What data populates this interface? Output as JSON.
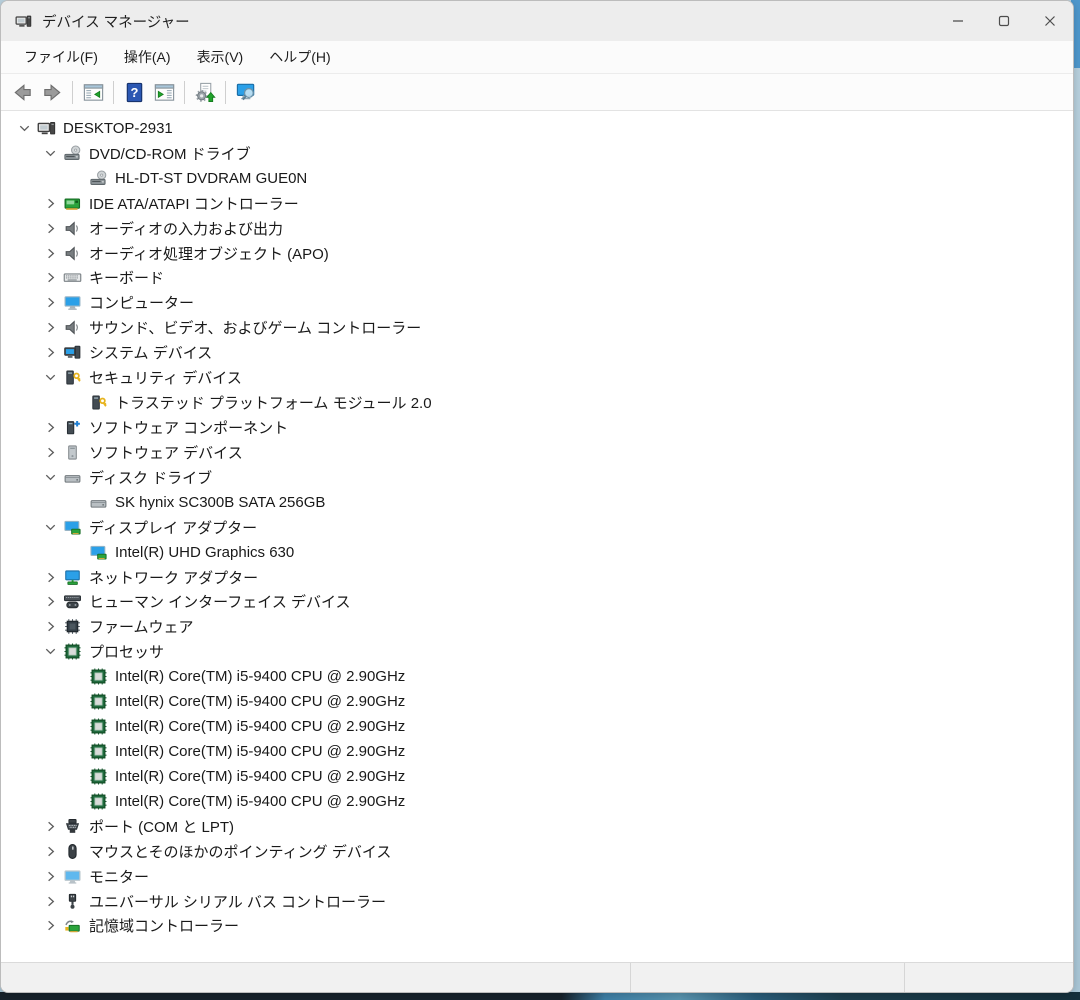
{
  "window": {
    "title": "デバイス マネージャー",
    "controls": [
      {
        "name": "minimize",
        "glyph": "minimize"
      },
      {
        "name": "maximize",
        "glyph": "maximize"
      },
      {
        "name": "close",
        "glyph": "close"
      }
    ]
  },
  "menu": {
    "items": [
      {
        "name": "file",
        "label": "ファイル(F)"
      },
      {
        "name": "action",
        "label": "操作(A)"
      },
      {
        "name": "view",
        "label": "表示(V)"
      },
      {
        "name": "help",
        "label": "ヘルプ(H)"
      }
    ]
  },
  "toolbar": {
    "buttons": [
      {
        "type": "button",
        "name": "back",
        "icon": "back-arrow"
      },
      {
        "type": "button",
        "name": "forward",
        "icon": "forward-arrow"
      },
      {
        "type": "separator"
      },
      {
        "type": "button",
        "name": "show-hide-console-tree",
        "icon": "console-tree-pane"
      },
      {
        "type": "separator"
      },
      {
        "type": "button",
        "name": "help",
        "icon": "help"
      },
      {
        "type": "button",
        "name": "show-hide-action-pane",
        "icon": "action-pane"
      },
      {
        "type": "separator"
      },
      {
        "type": "button",
        "name": "update-driver",
        "icon": "update-driver"
      },
      {
        "type": "separator"
      },
      {
        "type": "button",
        "name": "scan-hardware-changes",
        "icon": "scan-hardware"
      }
    ]
  },
  "tree": {
    "items": [
      {
        "label": "DESKTOP-2931",
        "level": 0,
        "state": "expanded",
        "icon": "computer"
      },
      {
        "label": "DVD/CD-ROM ドライブ",
        "level": 1,
        "state": "expanded",
        "icon": "dvd-drive"
      },
      {
        "label": "HL-DT-ST DVDRAM GUE0N",
        "level": 2,
        "state": "none",
        "icon": "dvd-drive"
      },
      {
        "label": "IDE ATA/ATAPI コントローラー",
        "level": 1,
        "state": "collapsed",
        "icon": "ide-card"
      },
      {
        "label": "オーディオの入力および出力",
        "level": 1,
        "state": "collapsed",
        "icon": "speaker"
      },
      {
        "label": "オーディオ処理オブジェクト (APO)",
        "level": 1,
        "state": "collapsed",
        "icon": "speaker"
      },
      {
        "label": "キーボード",
        "level": 1,
        "state": "collapsed",
        "icon": "keyboard"
      },
      {
        "label": "コンピューター",
        "level": 1,
        "state": "collapsed",
        "icon": "monitor-blue"
      },
      {
        "label": "サウンド、ビデオ、およびゲーム コントローラー",
        "level": 1,
        "state": "collapsed",
        "icon": "speaker"
      },
      {
        "label": "システム デバイス",
        "level": 1,
        "state": "collapsed",
        "icon": "system-devices"
      },
      {
        "label": "セキュリティ デバイス",
        "level": 1,
        "state": "expanded",
        "icon": "security-key"
      },
      {
        "label": "トラステッド プラットフォーム モジュール 2.0",
        "level": 2,
        "state": "none",
        "icon": "security-key"
      },
      {
        "label": "ソフトウェア コンポーネント",
        "level": 1,
        "state": "collapsed",
        "icon": "software-component"
      },
      {
        "label": "ソフトウェア デバイス",
        "level": 1,
        "state": "collapsed",
        "icon": "software-device"
      },
      {
        "label": "ディスク ドライブ",
        "level": 1,
        "state": "expanded",
        "icon": "disk-drive"
      },
      {
        "label": "SK hynix SC300B SATA 256GB",
        "level": 2,
        "state": "none",
        "icon": "disk-drive"
      },
      {
        "label": "ディスプレイ アダプター",
        "level": 1,
        "state": "expanded",
        "icon": "display-adapter"
      },
      {
        "label": "Intel(R) UHD Graphics 630",
        "level": 2,
        "state": "none",
        "icon": "display-adapter"
      },
      {
        "label": "ネットワーク アダプター",
        "level": 1,
        "state": "collapsed",
        "icon": "network-adapter"
      },
      {
        "label": "ヒューマン インターフェイス デバイス",
        "level": 1,
        "state": "collapsed",
        "icon": "hid"
      },
      {
        "label": "ファームウェア",
        "level": 1,
        "state": "collapsed",
        "icon": "firmware-chip"
      },
      {
        "label": "プロセッサ",
        "level": 1,
        "state": "expanded",
        "icon": "processor-chip"
      },
      {
        "label": "Intel(R) Core(TM) i5-9400 CPU @ 2.90GHz",
        "level": 2,
        "state": "none",
        "icon": "processor-chip"
      },
      {
        "label": "Intel(R) Core(TM) i5-9400 CPU @ 2.90GHz",
        "level": 2,
        "state": "none",
        "icon": "processor-chip"
      },
      {
        "label": "Intel(R) Core(TM) i5-9400 CPU @ 2.90GHz",
        "level": 2,
        "state": "none",
        "icon": "processor-chip"
      },
      {
        "label": "Intel(R) Core(TM) i5-9400 CPU @ 2.90GHz",
        "level": 2,
        "state": "none",
        "icon": "processor-chip"
      },
      {
        "label": "Intel(R) Core(TM) i5-9400 CPU @ 2.90GHz",
        "level": 2,
        "state": "none",
        "icon": "processor-chip"
      },
      {
        "label": "Intel(R) Core(TM) i5-9400 CPU @ 2.90GHz",
        "level": 2,
        "state": "none",
        "icon": "processor-chip"
      },
      {
        "label": "ポート (COM と LPT)",
        "level": 1,
        "state": "collapsed",
        "icon": "serial-port"
      },
      {
        "label": "マウスとそのほかのポインティング デバイス",
        "level": 1,
        "state": "collapsed",
        "icon": "mouse"
      },
      {
        "label": "モニター",
        "level": 1,
        "state": "collapsed",
        "icon": "monitor"
      },
      {
        "label": "ユニバーサル シリアル バス コントローラー",
        "level": 1,
        "state": "collapsed",
        "icon": "usb-plug"
      },
      {
        "label": "記憶域コントローラー",
        "level": 1,
        "state": "collapsed",
        "icon": "storage-card"
      }
    ]
  },
  "status_bar": {
    "sections": [
      "",
      "",
      ""
    ]
  },
  "colors": {
    "title_bar_bg": "#ededed",
    "status_bar_bg": "#f1f1f1",
    "help_blue": "#2b57b2",
    "device_green": "#2aa33c",
    "key_yellow": "#e7b41f",
    "monitor_blue": "#2ba0e8"
  }
}
